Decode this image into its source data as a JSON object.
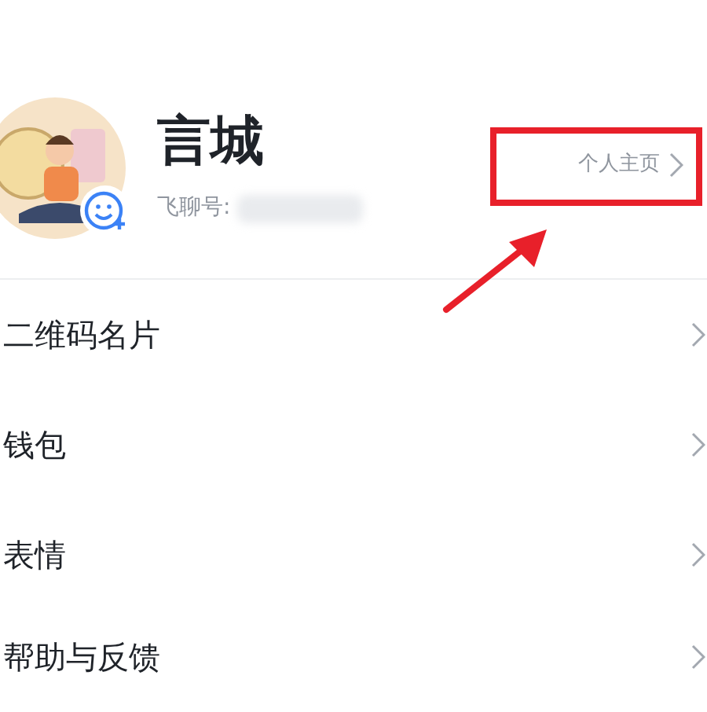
{
  "profile": {
    "name": "言城",
    "id_label": "飞聊号:",
    "homepage_link": "个人主页"
  },
  "menu": [
    {
      "label": "二维码名片"
    },
    {
      "label": "钱包"
    },
    {
      "label": "表情"
    },
    {
      "label": "帮助与反馈"
    }
  ]
}
